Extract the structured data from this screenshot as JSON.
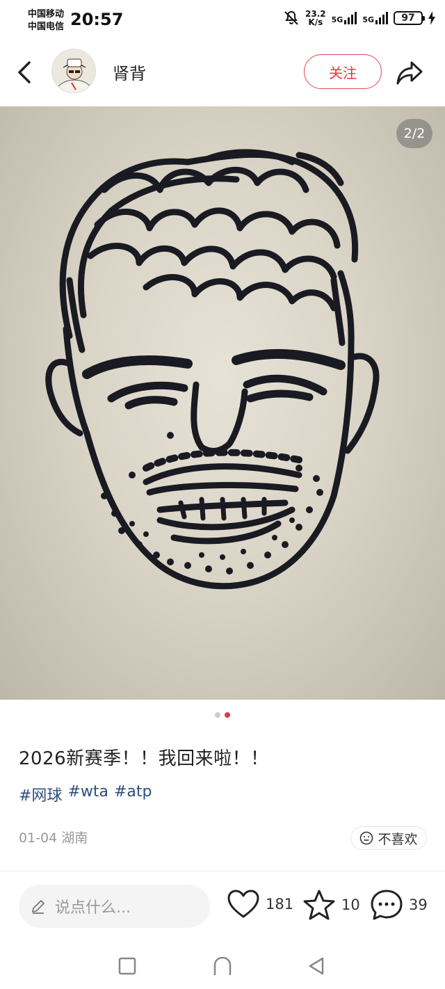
{
  "status": {
    "carrier1": "中国移动",
    "carrier2": "中国电信",
    "time": "20:57",
    "speed_top": "23.2",
    "speed_bottom": "K/s",
    "network1": "5G",
    "network2": "5G",
    "battery": "97"
  },
  "header": {
    "username": "肾背",
    "follow_label": "关注"
  },
  "image": {
    "counter": "2/2",
    "total": 2,
    "current": 2
  },
  "post": {
    "title": "2026新赛季！！我回来啦！！",
    "tags": [
      "#网球",
      "#wta",
      "#atp"
    ],
    "date": "01-04",
    "location": "湖南",
    "dislike_label": "不喜欢"
  },
  "actions": {
    "comment_placeholder": "说点什么...",
    "likes": "181",
    "favorites": "10",
    "comments": "39"
  },
  "colors": {
    "accent": "#e0383f",
    "tag": "#2c4f7c"
  }
}
